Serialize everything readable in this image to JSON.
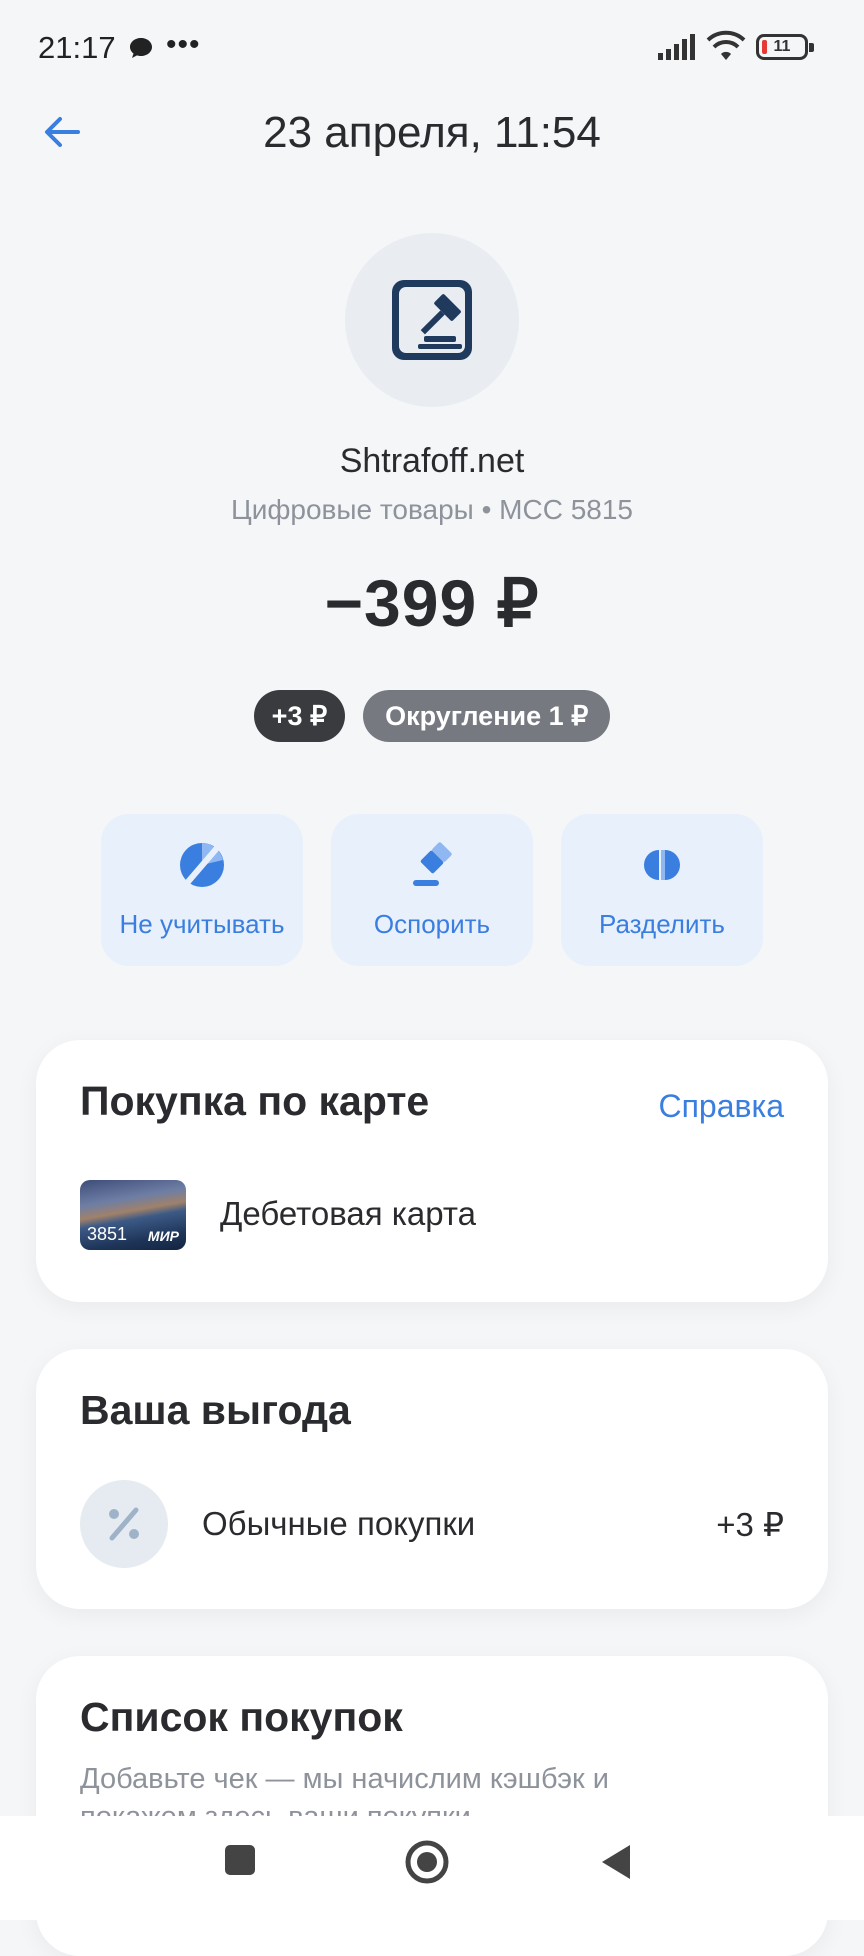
{
  "status_bar": {
    "time": "21:17",
    "dots": "•••",
    "battery": "11"
  },
  "header": {
    "title": "23 апреля, 11:54"
  },
  "merchant": {
    "icon": "gavel-icon",
    "name": "Shtrafoff.net",
    "category": "Цифровые товары • MCC 5815"
  },
  "amount": "−399 ₽",
  "pills": {
    "cashback": "+3 ₽",
    "rounding": "Округление 1 ₽"
  },
  "actions": [
    {
      "label": "Не учитывать",
      "icon": "exclude-icon"
    },
    {
      "label": "Оспорить",
      "icon": "dispute-gavel-icon"
    },
    {
      "label": "Разделить",
      "icon": "split-icon"
    }
  ],
  "card_purchase": {
    "title": "Покупка по карте",
    "help": "Справка",
    "card_number": "3851",
    "card_network": "МИР",
    "card_label": "Дебетовая карта"
  },
  "benefit": {
    "title": "Ваша выгода",
    "item_label": "Обычные покупки",
    "item_value": "+3 ₽"
  },
  "purchase_list": {
    "title": "Список покупок",
    "description": "Добавьте чек — мы начислим кэшбэк и покажем здесь ваши покупки"
  },
  "colors": {
    "accent": "#3a7ee0",
    "action_bg": "#e8f0fc",
    "background": "#f5f6f8",
    "dark_pill": "#3a3b3e",
    "gray_pill": "#767a80"
  }
}
